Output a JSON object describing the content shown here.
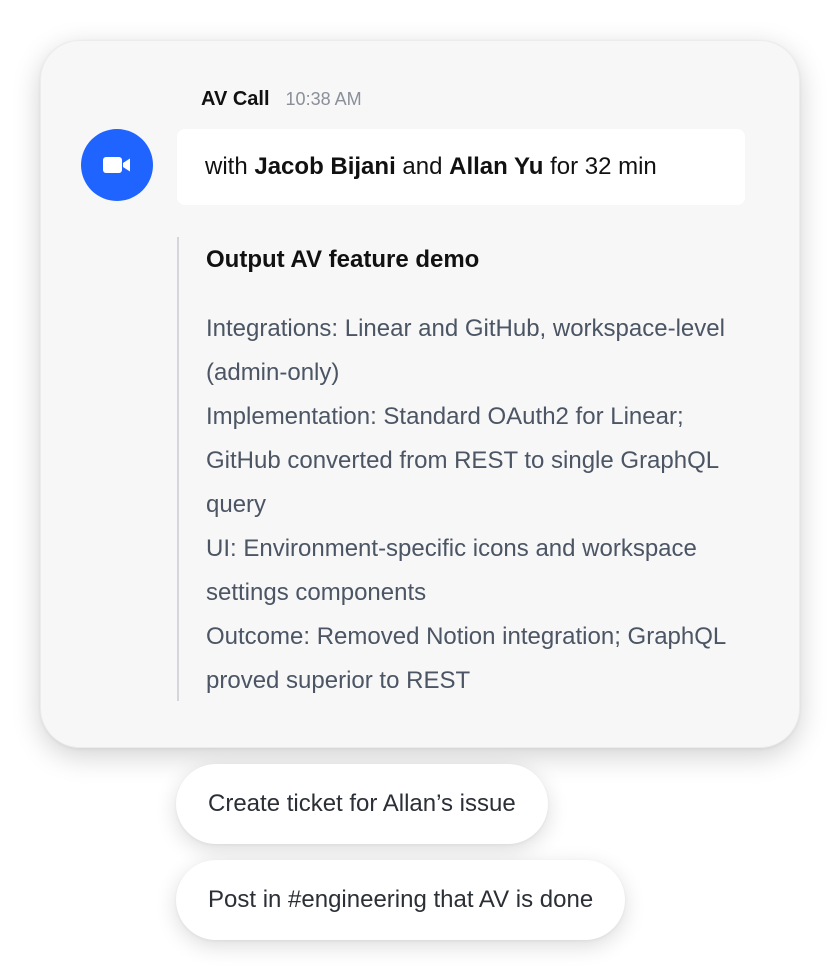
{
  "call": {
    "title": "AV Call",
    "time": "10:38 AM",
    "participants": {
      "prefix": "with",
      "person1": "Jacob Bijani",
      "conjunction": "and",
      "person2": "Allan Yu",
      "duration_text": "for 32 min"
    },
    "icon": "video-camera-icon",
    "accent_color": "#1f64ff"
  },
  "summary": {
    "heading": "Output AV feature demo",
    "lines": [
      "Integrations: Linear and GitHub, workspace-level (admin-only)",
      "Implementation: Standard OAuth2 for Linear; GitHub converted from REST to single GraphQL query",
      "UI: Environment-specific icons and workspace settings components",
      "Outcome: Removed Notion integration; GraphQL proved superior to REST"
    ]
  },
  "suggestions": [
    "Create ticket for Allan’s issue",
    "Post in #engineering that AV is done"
  ]
}
